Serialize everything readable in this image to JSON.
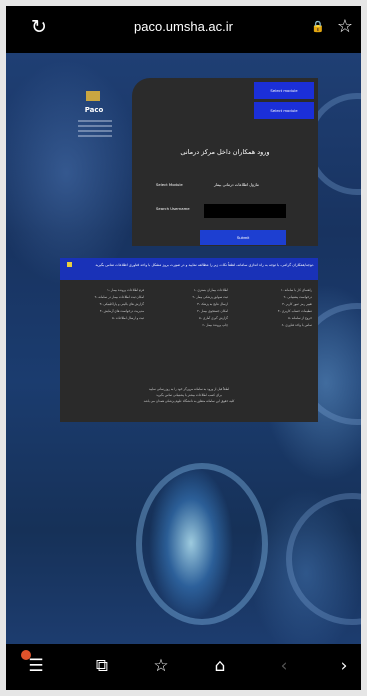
{
  "browser": {
    "url": "paco.umsha.ac.ir",
    "reload_icon": "↻",
    "lock_icon": "🔒",
    "star_icon": "☆"
  },
  "sidebar": {
    "title": "Paco"
  },
  "login": {
    "toggle_top": "Select module",
    "toggle_bottom": "Select module",
    "title": "ورود همکاران داخل مرکز درمانی",
    "username_label": "Select Module",
    "username_value": "ماژول اطلاعات درمانی بیمار",
    "password_label": "Search Username",
    "submit_label": "Submit"
  },
  "notice": {
    "header": "توجه/همکاران گرامی، با توجه به راه اندازی سامانه، لطفاً نکات زیر را مطالعه نمایید و در صورت بروز مشکل با واحد فناوری اطلاعات تماس بگیرید.",
    "columns": [
      [
        "۱- فرم اطلاعات پرونده بیمار",
        "۲- امکان ثبت اطلاعات بیمار در سامانه",
        "۳- گزارش های بالینی و پاراکلینیکی",
        "۴- مدیریت درخواست های آزمایش",
        "۵- ثبت و ارسال اطلاعات"
      ],
      [
        "۱- اطلاعات بیماران بستری",
        "۲- ثبت سوابق پزشکی بیمار",
        "۳- ارسال نتایج به پزشک",
        "۴- امکان جستجوی بیمار",
        "۵- گزارش گیری آماری",
        "۶- چاپ پرونده بیمار"
      ],
      [
        "۱- راهنمای کار با سامانه",
        "۲- درخواست پشتیبانی",
        "۳- تغییر رمز عبور کاربر",
        "۴- تنظیمات حساب کاربری",
        "۵- خروج از سامانه",
        "۶- تماس با واحد فناوری"
      ]
    ],
    "footer": [
      "لطفاً قبل از ورود به سامانه مرورگر خود را به روزرسانی نمایید",
      "برای کسب اطلاعات بیشتر با پشتیبانی تماس بگیرید",
      "کلیه حقوق این سامانه متعلق به دانشگاه علوم پزشکی همدان می باشد"
    ]
  },
  "bottombar": {
    "menu_icon": "☰",
    "tabs_icon": "⧉",
    "bookmarks_icon": "☆",
    "home_icon": "⌂",
    "back_icon": "‹",
    "forward_icon": "›"
  }
}
